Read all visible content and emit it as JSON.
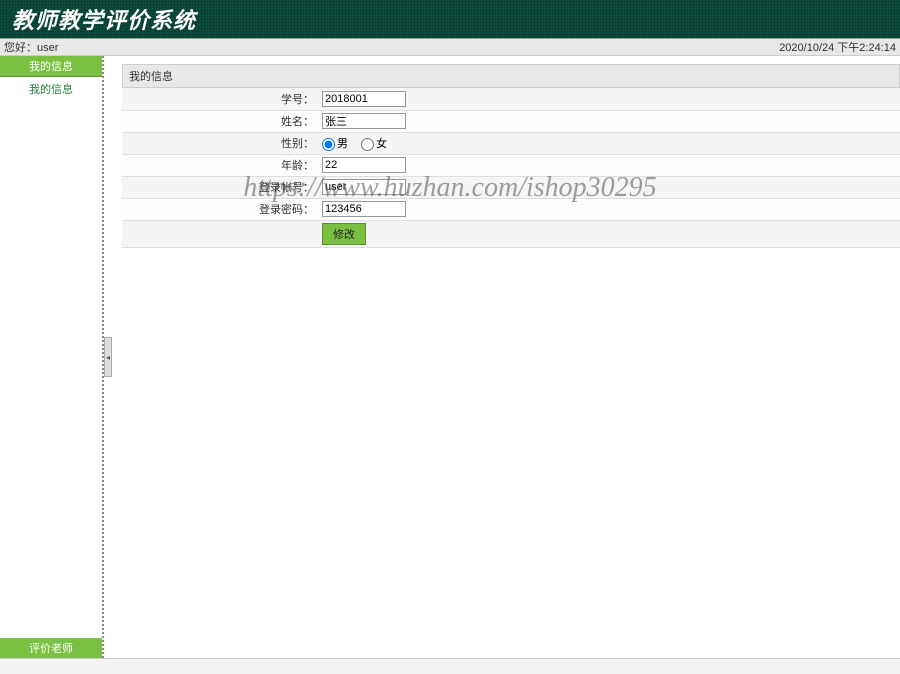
{
  "header": {
    "title": "教师教学评价系统"
  },
  "topbar": {
    "greeting_label": "您好：",
    "username": "user",
    "datetime": "2020/10/24 下午2:24:14"
  },
  "sidebar": {
    "header": "我的信息",
    "items": [
      {
        "label": "我的信息"
      }
    ],
    "footer": "评价老师"
  },
  "main": {
    "panel_title": "我的信息",
    "form": {
      "student_id": {
        "label": "学号：",
        "value": "2018001"
      },
      "name": {
        "label": "姓名：",
        "value": "张三"
      },
      "gender": {
        "label": "性别：",
        "male": "男",
        "female": "女",
        "selected": "male"
      },
      "age": {
        "label": "年龄：",
        "value": "22"
      },
      "login": {
        "label": "登录帐号：",
        "value": "user"
      },
      "password": {
        "label": "登录密码：",
        "value": "123456"
      },
      "submit_label": "修改"
    }
  },
  "watermark": "https://www.huzhan.com/ishop30295",
  "statusbar": ""
}
